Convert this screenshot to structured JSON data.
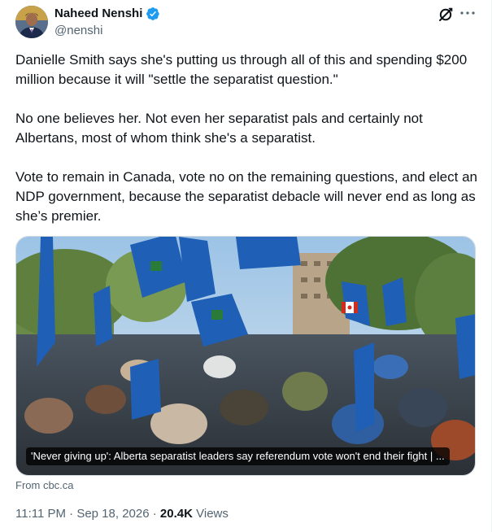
{
  "author": {
    "name": "Naheed Nenshi",
    "handle": "@nenshi",
    "verified": true
  },
  "tweet": {
    "paragraphs": [
      "Danielle Smith says she's putting us through all of this and spending $200 million because it will \"settle the separatist question.\"",
      "No one believes her. Not even her separatist pals and certainly not Albertans, most of whom think she's a separatist.",
      "Vote to remain in Canada, vote no on the remaining questions, and elect an NDP government, because the separatist debacle will never end as long as she’s premier."
    ]
  },
  "link_card": {
    "caption": "'Never giving up': Alberta separatist leaders say referendum vote won't end their fight | ...",
    "source": "From cbc.ca"
  },
  "meta": {
    "time": "11:11 PM",
    "separator": "·",
    "date": "Sep 18, 2026",
    "views_count": "20.4K",
    "views_label": "Views"
  },
  "colors": {
    "text_primary": "#0f1419",
    "text_secondary": "#536471",
    "verified_blue": "#1d9bf0",
    "border": "#cfd9de"
  },
  "icons": {
    "verified": "verified-badge-icon",
    "grok": "grok-icon",
    "more": "more-options-icon"
  }
}
